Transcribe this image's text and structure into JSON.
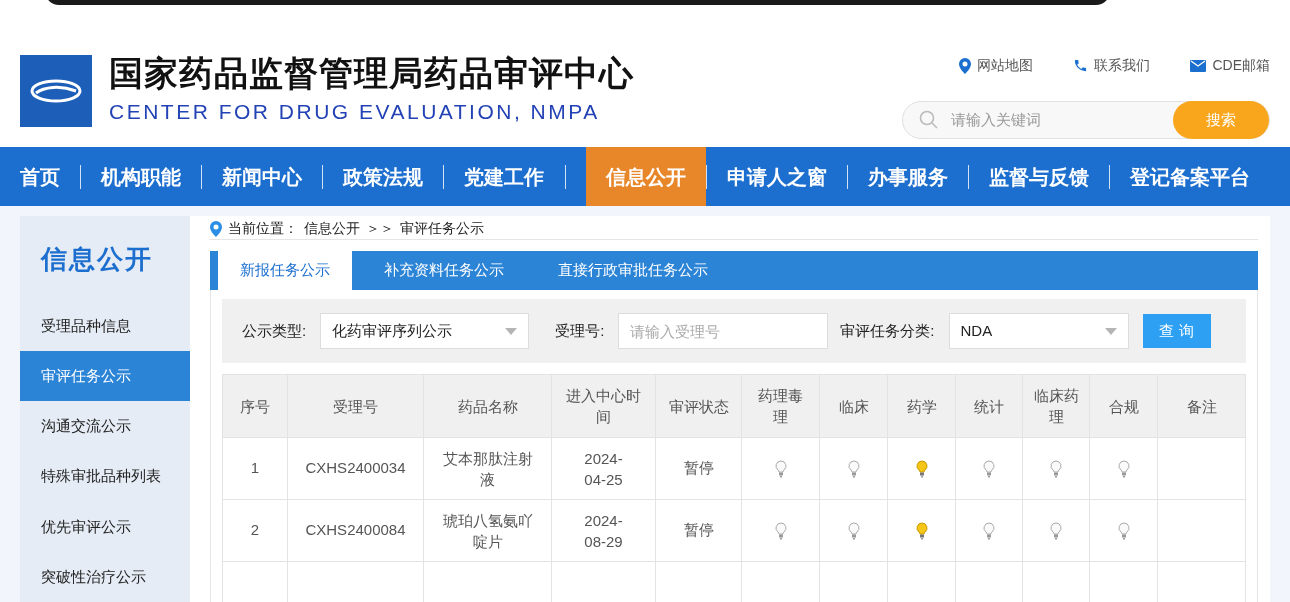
{
  "header": {
    "title_cn": "国家药品监督管理局药品审评中心",
    "title_en": "CENTER FOR DRUG EVALUATION, NMPA",
    "links": [
      {
        "kind": "map",
        "label": "网站地图"
      },
      {
        "kind": "phone",
        "label": "联系我们"
      },
      {
        "kind": "mail",
        "label": "CDE邮箱"
      }
    ],
    "search": {
      "placeholder": "请输入关键词",
      "button": "搜索"
    }
  },
  "nav": [
    {
      "label": "首页",
      "selected": false
    },
    {
      "label": "机构职能",
      "selected": false
    },
    {
      "label": "新闻中心",
      "selected": false
    },
    {
      "label": "政策法规",
      "selected": false
    },
    {
      "label": "党建工作",
      "selected": false
    },
    {
      "label": "信息公开",
      "selected": true
    },
    {
      "label": "申请人之窗",
      "selected": false
    },
    {
      "label": "办事服务",
      "selected": false
    },
    {
      "label": "监督与反馈",
      "selected": false
    },
    {
      "label": "登记备案平台",
      "selected": false
    }
  ],
  "sidebar": {
    "title": "信息公开",
    "items": [
      {
        "label": "受理品种信息",
        "selected": false
      },
      {
        "label": "审评任务公示",
        "selected": true
      },
      {
        "label": "沟通交流公示",
        "selected": false
      },
      {
        "label": "特殊审批品种列表",
        "selected": false
      },
      {
        "label": "优先审评公示",
        "selected": false
      },
      {
        "label": "突破性治疗公示",
        "selected": false
      }
    ]
  },
  "breadcrumb": {
    "prefix": "当前位置：",
    "parts": [
      "信息公开",
      "审评任务公示"
    ],
    "separator": "＞＞"
  },
  "tabs": [
    {
      "label": "新报任务公示",
      "selected": true
    },
    {
      "label": "补充资料任务公示",
      "selected": false
    },
    {
      "label": "直接行政审批任务公示",
      "selected": false
    }
  ],
  "filters": {
    "type_label": "公示类型:",
    "type_value": "化药审评序列公示",
    "number_label": "受理号:",
    "number_placeholder": "请输入受理号",
    "category_label": "审评任务分类:",
    "category_value": "NDA",
    "button": "查 询"
  },
  "table": {
    "columns": [
      "序号",
      "受理号",
      "药品名称",
      "进入中心时间",
      "审评状态",
      "药理毒理",
      "临床",
      "药学",
      "统计",
      "临床药理",
      "合规",
      "备注"
    ],
    "rows": [
      {
        "index": "1",
        "number": "CXHS2400034",
        "drug": "艾本那肽注射液",
        "date": "2024-04-25",
        "status": "暂停",
        "bulbs": [
          {
            "lit": false
          },
          {
            "lit": false
          },
          {
            "lit": true
          },
          {
            "lit": false
          },
          {
            "lit": false
          },
          {
            "lit": false
          }
        ]
      },
      {
        "index": "2",
        "number": "CXHS2400084",
        "drug": "琥珀八氢氨吖啶片",
        "date": "2024-08-29",
        "status": "暂停",
        "bulbs": [
          {
            "lit": false
          },
          {
            "lit": false
          },
          {
            "lit": true
          },
          {
            "lit": false
          },
          {
            "lit": false
          },
          {
            "lit": false
          }
        ]
      }
    ]
  }
}
